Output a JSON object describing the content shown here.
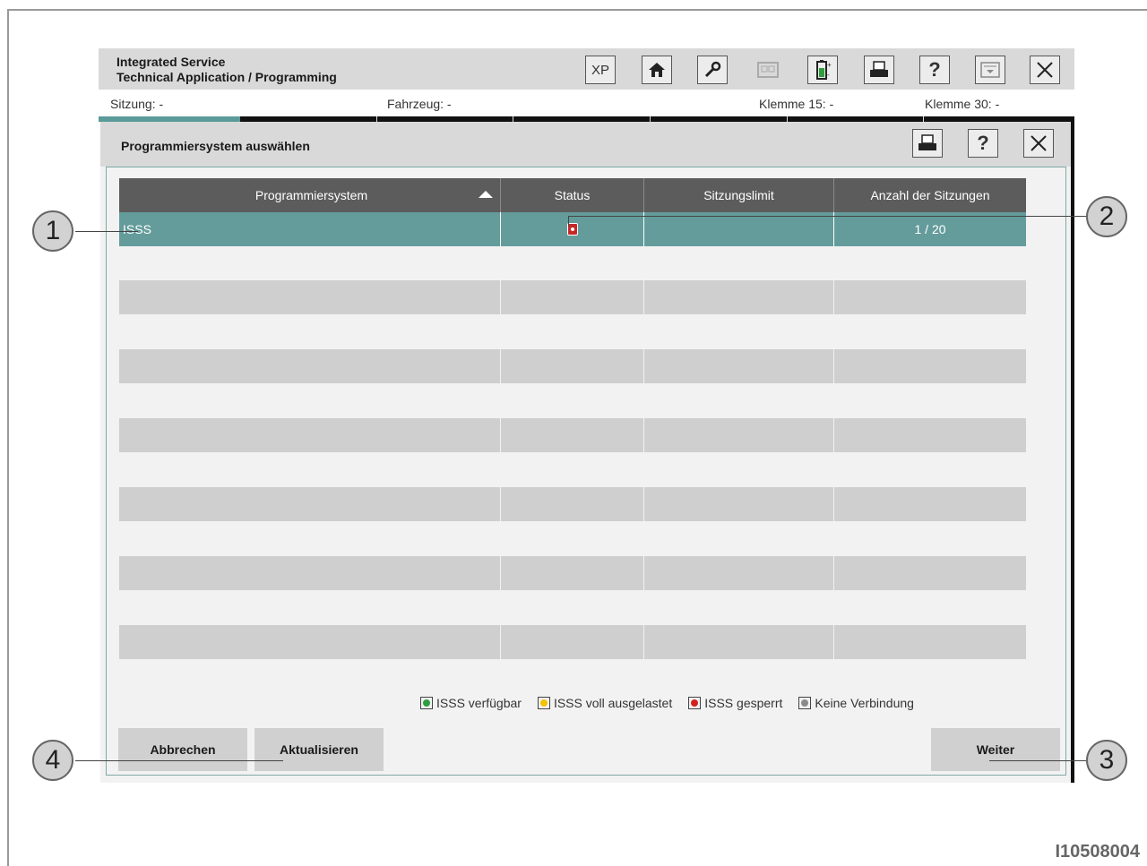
{
  "app": {
    "title_line1": "Integrated Service",
    "title_line2": "Technical Application / Programming",
    "toolbar": [
      "XP",
      "home-icon",
      "wrench-icon",
      "panel-icon",
      "battery-icon",
      "print-icon",
      "help-icon",
      "minimize-icon",
      "close-icon"
    ]
  },
  "status": {
    "sitzung": "Sitzung:  -",
    "fahrzeug": "Fahrzeug:  -",
    "klemme15": "Klemme 15:  -",
    "klemme30": "Klemme 30:  -"
  },
  "dialog": {
    "title": "Programmiersystem auswählen",
    "columns": [
      "Programmiersystem",
      "Status",
      "Sitzungslimit",
      "Anzahl der Sitzungen"
    ],
    "rows": [
      {
        "system": "ISSS",
        "status": "gesperrt",
        "limit": "",
        "sessions": "1 / 20"
      }
    ],
    "legend": [
      "ISSS verfügbar",
      "ISSS voll ausgelastet",
      "ISSS gesperrt",
      "Keine Verbindung"
    ],
    "legend_colors": [
      "#2e9e3e",
      "#f2c200",
      "#d32020",
      "#8a8a8a"
    ],
    "buttons": {
      "cancel": "Abbrechen",
      "refresh": "Aktualisieren",
      "next": "Weiter"
    }
  },
  "callouts": [
    "1",
    "2",
    "3",
    "4"
  ],
  "figure_id": "I10508004"
}
